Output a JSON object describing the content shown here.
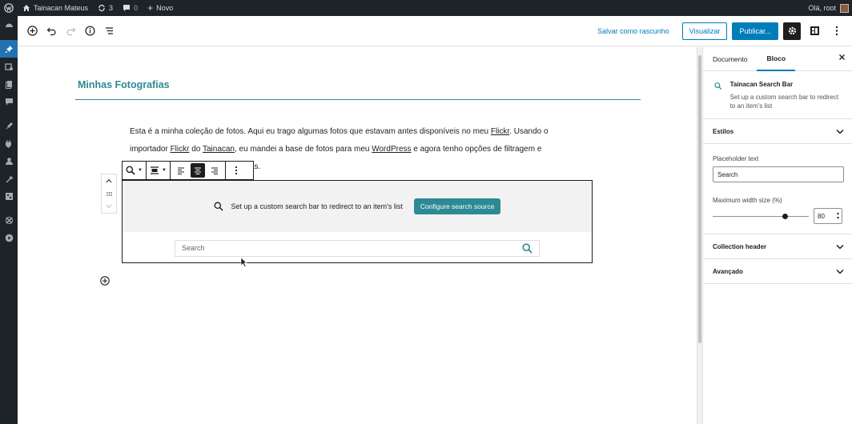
{
  "adminbar": {
    "site_name": "Tainacan Mateus",
    "updates_count": "3",
    "comments_count": "0",
    "new_label": "Novo",
    "greeting": "Olá, root"
  },
  "leftmenu": {
    "icons": [
      "dashboard-icon",
      "pin-icon",
      "media-icon",
      "pages-icon",
      "comments-icon",
      "appearance-icon",
      "plugins-icon",
      "users-icon",
      "tools-icon",
      "settings-icon",
      "tainacan-icon",
      "play-icon"
    ]
  },
  "toolbar": {
    "save_draft": "Salvar como rascunho",
    "preview": "Visualizar",
    "publish": "Publicar..."
  },
  "editor": {
    "title": "Minhas Fotografias",
    "paragraph": {
      "line1_a": "Esta é a minha coleção de fotos. Aqui eu trago algumas fotos que estavam antes disponíveis no meu ",
      "line1_link": "Flickr",
      "line1_b": ". Usando o",
      "line2_a": "importador ",
      "line2_link1": "Flickr",
      "line2_b": " do ",
      "line2_link2": "Tainacan",
      "line2_c": ", eu mandei a base de fotos para meu ",
      "line2_link3": "WordPress",
      "line2_d": " e agora tenho opções de filtragem e",
      "line3_tail": "as."
    },
    "search_block": {
      "setup_text": "Set up a custom search bar to redirect to an item's list",
      "configure_button": "Configure search source",
      "search_placeholder": "Search"
    }
  },
  "sidebar": {
    "tabs": [
      "Documento",
      "Bloco"
    ],
    "active_tab": "Bloco",
    "block_card": {
      "title": "Tainacan Search Bar",
      "description": "Set up a custom search bar to redirect to an item's list"
    },
    "panels": {
      "styles": "Estilos",
      "placeholder_label": "Placeholder text",
      "placeholder_value": "Search",
      "max_width_label": "Maximum width size (%)",
      "max_width_value": "80",
      "collection_header": "Collection header",
      "advanced": "Avançado"
    }
  },
  "colors": {
    "accent": "#007cba",
    "tainacan_teal": "#2c8a94",
    "admin_dark": "#1d2327"
  }
}
